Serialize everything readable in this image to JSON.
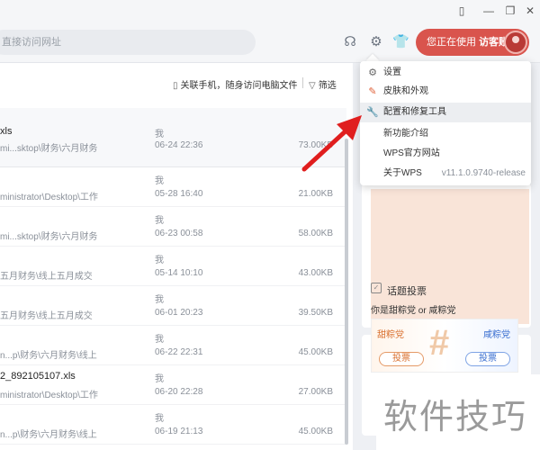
{
  "topbar": {
    "search_placeholder": "直接访问网址",
    "user_status": "您正在使用",
    "user_account": "访客账号"
  },
  "list_toolbar": {
    "link_phone": "关联手机，随身访问电脑文件",
    "filter": "筛选"
  },
  "files": [
    {
      "name": "xls",
      "path": "mi...sktop\\财务\\六月财务",
      "who": "我",
      "time": "06-24 22:36",
      "size": "73.00KB"
    },
    {
      "name": "",
      "path": "ministrator\\Desktop\\工作",
      "who": "我",
      "time": "05-28 16:40",
      "size": "21.00KB"
    },
    {
      "name": "",
      "path": "mi...sktop\\财务\\六月财务",
      "who": "我",
      "time": "06-23 00:58",
      "size": "58.00KB"
    },
    {
      "name": "",
      "path": "五月财务\\线上五月成交",
      "who": "我",
      "time": "05-14 10:10",
      "size": "43.00KB"
    },
    {
      "name": "",
      "path": "五月财务\\线上五月成交",
      "who": "我",
      "time": "06-01 20:23",
      "size": "39.50KB"
    },
    {
      "name": "",
      "path": "n...p\\财务\\六月财务\\线上",
      "who": "我",
      "time": "06-22 22:31",
      "size": "45.00KB"
    },
    {
      "name": "2_892105107.xls",
      "path": "ministrator\\Desktop\\工作",
      "who": "我",
      "time": "06-20 22:28",
      "size": "27.00KB"
    },
    {
      "name": "",
      "path": "n...p\\财务\\六月财务\\线上",
      "who": "我",
      "time": "06-19 21:13",
      "size": "45.00KB"
    }
  ],
  "menu": {
    "items": [
      {
        "label": "设置",
        "icon": "gear-icon"
      },
      {
        "label": "皮肤和外观",
        "icon": "brush-icon"
      },
      {
        "label": "配置和修复工具",
        "icon": "wrench-icon"
      },
      {
        "label": "新功能介绍"
      },
      {
        "label": "WPS官方网站"
      },
      {
        "label": "关于WPS",
        "version": "v11.1.0.9740-release"
      }
    ]
  },
  "topic": {
    "title": "话题投票",
    "question": "你是甜粽党 or 咸粽党",
    "sweet_label": "甜粽党",
    "salty_label": "咸粽党",
    "vote_label": "投票"
  },
  "watermark": "软件技巧",
  "colors": {
    "user_button": "#d9544d",
    "arrow": "#e01e1e"
  }
}
